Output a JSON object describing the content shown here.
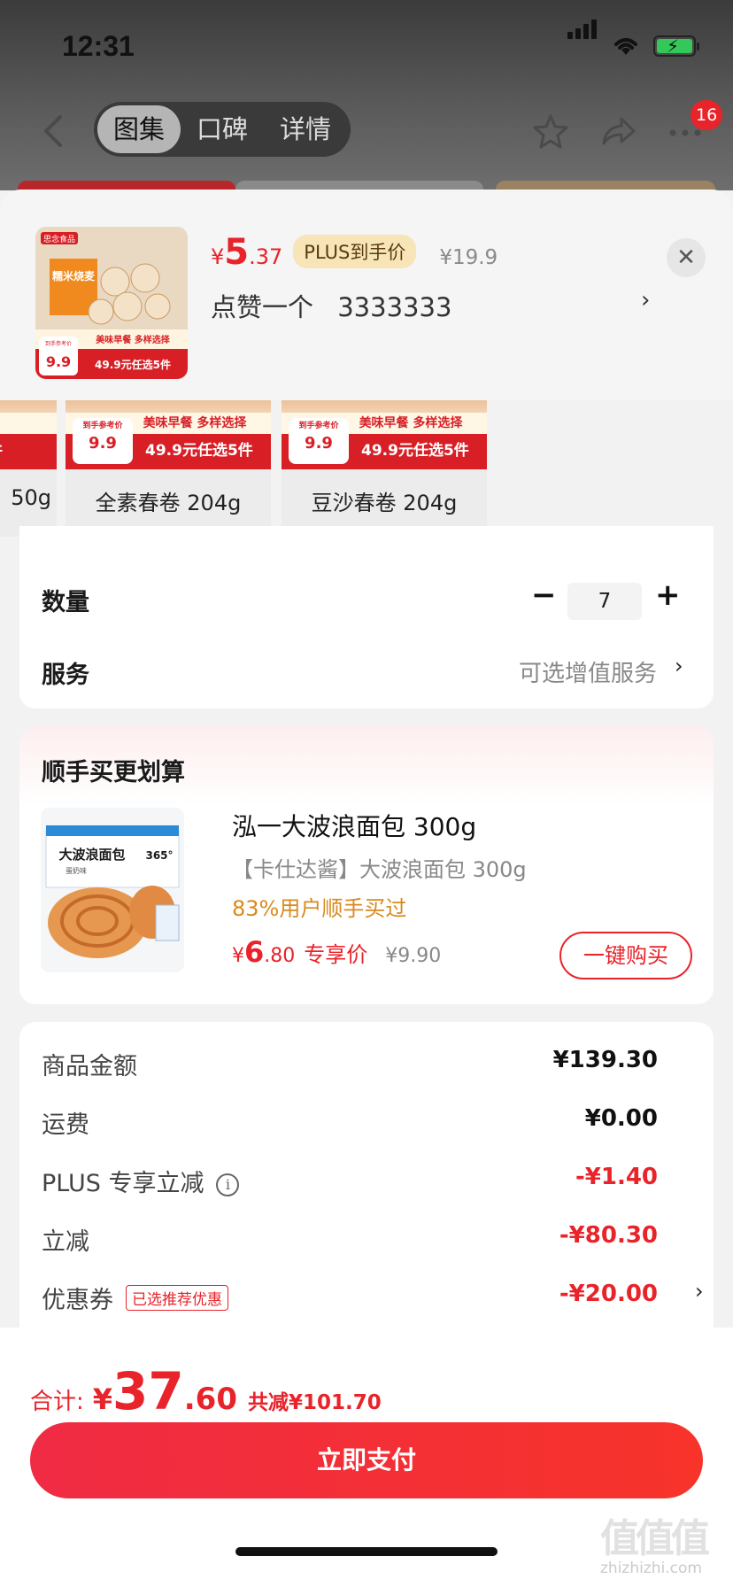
{
  "status_bar": {
    "time": "12:31"
  },
  "nav": {
    "tabs": [
      "图集",
      "口碑",
      "详情"
    ],
    "badge": "16"
  },
  "sheet": {
    "price": {
      "currency": "¥",
      "integer": "5",
      "decimal": ".37",
      "plus_label": "PLUS到手价",
      "original": "¥19.9"
    },
    "selected": {
      "prefix": "点赞一个",
      "value": "3333333"
    },
    "product_image_text": {
      "brand": "思念食品",
      "name": "糯米烧麦",
      "banner_top": "美味早餐 多样选择",
      "banner_bottom": "49.9元任选5件",
      "badge_top": "到手参考价",
      "badge_price": "9.9"
    }
  },
  "options": [
    {
      "label": "50g",
      "banner_top": "",
      "banner_bottom": "件",
      "badge_top": "",
      "badge_price": ""
    },
    {
      "label": "全素春卷 204g",
      "banner_top": "美味早餐 多样选择",
      "banner_bottom": "49.9元任选5件",
      "badge_top": "到手参考价",
      "badge_price": "9.9"
    },
    {
      "label": "豆沙春卷 204g",
      "banner_top": "美味早餐 多样选择",
      "banner_bottom": "49.9元任选5件",
      "badge_top": "到手参考价",
      "badge_price": "9.9"
    }
  ],
  "quantity": {
    "label": "数量",
    "value": "7",
    "minus": "−",
    "plus": "+"
  },
  "service": {
    "label": "服务",
    "value": "可选增值服务"
  },
  "combo": {
    "title": "顺手买更划算",
    "image_text": {
      "main": "大波浪面包",
      "sub": "蛋奶味",
      "badge": "365°"
    },
    "name": "泓一大波浪面包 300g",
    "spec": "【卡仕达酱】大波浪面包 300g",
    "rate": "83%用户顺手买过",
    "price_currency": "¥",
    "price_integer": "6",
    "price_decimal": ".80",
    "price_tag": "专享价",
    "original": "¥9.90",
    "buy_label": "一键购买"
  },
  "summary": [
    {
      "label": "商品金额",
      "value": "¥139.30",
      "negative": false
    },
    {
      "label": "运费",
      "value": "¥0.00",
      "negative": false
    },
    {
      "label": "PLUS 专享立减",
      "value": "-¥1.40",
      "negative": true
    },
    {
      "label": "立减",
      "value": "-¥80.30",
      "negative": true
    },
    {
      "label": "优惠券",
      "tag": "已选推荐优惠",
      "value": "-¥20.00",
      "negative": true
    }
  ],
  "footer": {
    "total_label": "合计:",
    "total_currency": "¥",
    "total_integer": "37",
    "total_decimal": ".60",
    "saved": "共减¥101.70",
    "pay_label": "立即支付"
  },
  "watermark": {
    "main": "值值值",
    "sub": "zhizhizhi.com"
  },
  "colors": {
    "accent": "#e8232a",
    "plus_tag_bg": "#f7e5b8",
    "rate_orange": "#d98a1f"
  }
}
